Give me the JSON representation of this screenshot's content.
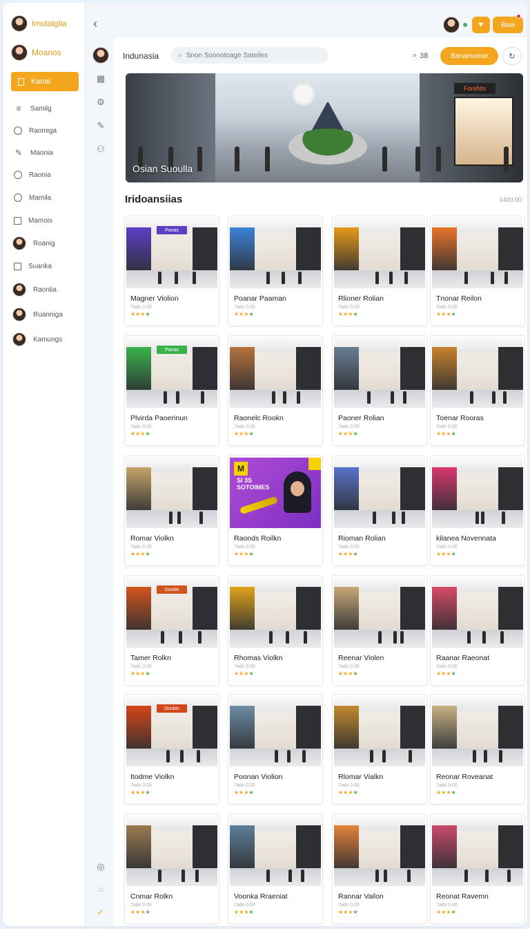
{
  "sidebar": {
    "profile_top": "Imolalglia",
    "profile_second": "Moanos",
    "active_label": "Kanal",
    "items": [
      {
        "label": "Samilg",
        "icon": "list-icon"
      },
      {
        "label": "Raomiga",
        "icon": "smile-icon"
      },
      {
        "label": "Maonia",
        "icon": "pencil-icon"
      },
      {
        "label": "Raonia",
        "icon": "circle-icon"
      },
      {
        "label": "Mamila",
        "icon": "chat-icon"
      },
      {
        "label": "Mamois",
        "icon": "square-icon"
      },
      {
        "label": "Roanig",
        "icon": "avatar"
      },
      {
        "label": "Suanka",
        "icon": "doc-icon"
      },
      {
        "label": "Raonlia",
        "icon": "avatar"
      },
      {
        "label": "Ruanniga",
        "icon": "avatar"
      },
      {
        "label": "Kamungs",
        "icon": "avatar"
      }
    ]
  },
  "topbar": {
    "title": "Indunasia",
    "search_placeholder": "Snon Soonotoage Sateiles",
    "count": "38",
    "primary_button": "Banamuooe",
    "top_action": "Baia"
  },
  "hero": {
    "caption": "Osian Suoulla",
    "shop_sign": "ForeNts"
  },
  "section": {
    "title": "Iridoansiias",
    "meta": "1400.00"
  },
  "cards": [
    {
      "name": "Magner Violion",
      "sub": "7ads 0.00",
      "sign": "Panas",
      "accent": "#5b3fc4"
    },
    {
      "name": "Poanar Paaman",
      "sub": "7ads 0.00",
      "sign": "",
      "accent": "#3c83d9"
    },
    {
      "name": "Rlioner Rolian",
      "sub": "7ads 0.00",
      "sign": "",
      "accent": "#e59a1b"
    },
    {
      "name": "Tnonar Reilon",
      "sub": "7ads 0.00",
      "sign": "",
      "accent": "#e8742a"
    },
    {
      "name": "Plvirda Paoerinun",
      "sub": "7ads 0.00",
      "sign": "Panas",
      "accent": "#3ab24b"
    },
    {
      "name": "Raonelc Rookn",
      "sub": "7ads 0.00",
      "sign": "",
      "accent": "#b7733d"
    },
    {
      "name": "Paoner Rolian",
      "sub": "7ads 0.00",
      "sign": "",
      "accent": "#6a7d94"
    },
    {
      "name": "Toenar Rooras",
      "sub": "7ads 0.00",
      "sign": "",
      "accent": "#c9822c"
    },
    {
      "name": "Romar Violkn",
      "sub": "7ads 0.00",
      "sign": "",
      "accent": "#c7a46a"
    },
    {
      "name": "Raonds Roilkn",
      "sub": "7ads 0.00",
      "sign": "M",
      "accent": "#a84ad1"
    },
    {
      "name": "Rioman Rolian",
      "sub": "7ads 0.00",
      "sign": "",
      "accent": "#5873c9"
    },
    {
      "name": "kilanea Novennata",
      "sub": "7ads 0.00",
      "sign": "",
      "accent": "#d9376f"
    },
    {
      "name": "Tamer Rolkn",
      "sub": "7ads 0.00",
      "sign": "Donbe",
      "accent": "#d2541c"
    },
    {
      "name": "Rhomas Violkn",
      "sub": "7ads 0.00",
      "sign": "",
      "accent": "#e0a319"
    },
    {
      "name": "Reenar Violen",
      "sub": "7ads 0.00",
      "sign": "",
      "accent": "#c6a678"
    },
    {
      "name": "Raanar Raeonat",
      "sub": "7ads 0.00",
      "sign": "",
      "accent": "#d74a64"
    },
    {
      "name": "Itodme Violkn",
      "sub": "7ads 0.00",
      "sign": "Donbis",
      "accent": "#d4461a"
    },
    {
      "name": "Poonan Violion",
      "sub": "7ads 0.00",
      "sign": "",
      "accent": "#6f8da6"
    },
    {
      "name": "Rlomar Vialkn",
      "sub": "7ads 0.00",
      "sign": "",
      "accent": "#c1892d"
    },
    {
      "name": "Reonar Roveanat",
      "sub": "7ads 0.00",
      "sign": "",
      "accent": "#c8b083"
    },
    {
      "name": "Cnmar Rolkn",
      "sub": "7ads 0.00",
      "sign": "",
      "accent": "#9c7a52"
    },
    {
      "name": "Voonka Rraeniat",
      "sub": "7ads 0.00",
      "sign": "",
      "accent": "#5f7f9a"
    },
    {
      "name": "Rannar Vailon",
      "sub": "7ads 0.00",
      "sign": "",
      "accent": "#e5823a"
    },
    {
      "name": "Reonat Ravemn",
      "sub": "7ads 0.00",
      "sign": "",
      "accent": "#c94a6b"
    }
  ],
  "colors": {
    "accent": "#f4a61e",
    "star": "#f4a61e",
    "star_alt": "#4caf50"
  }
}
